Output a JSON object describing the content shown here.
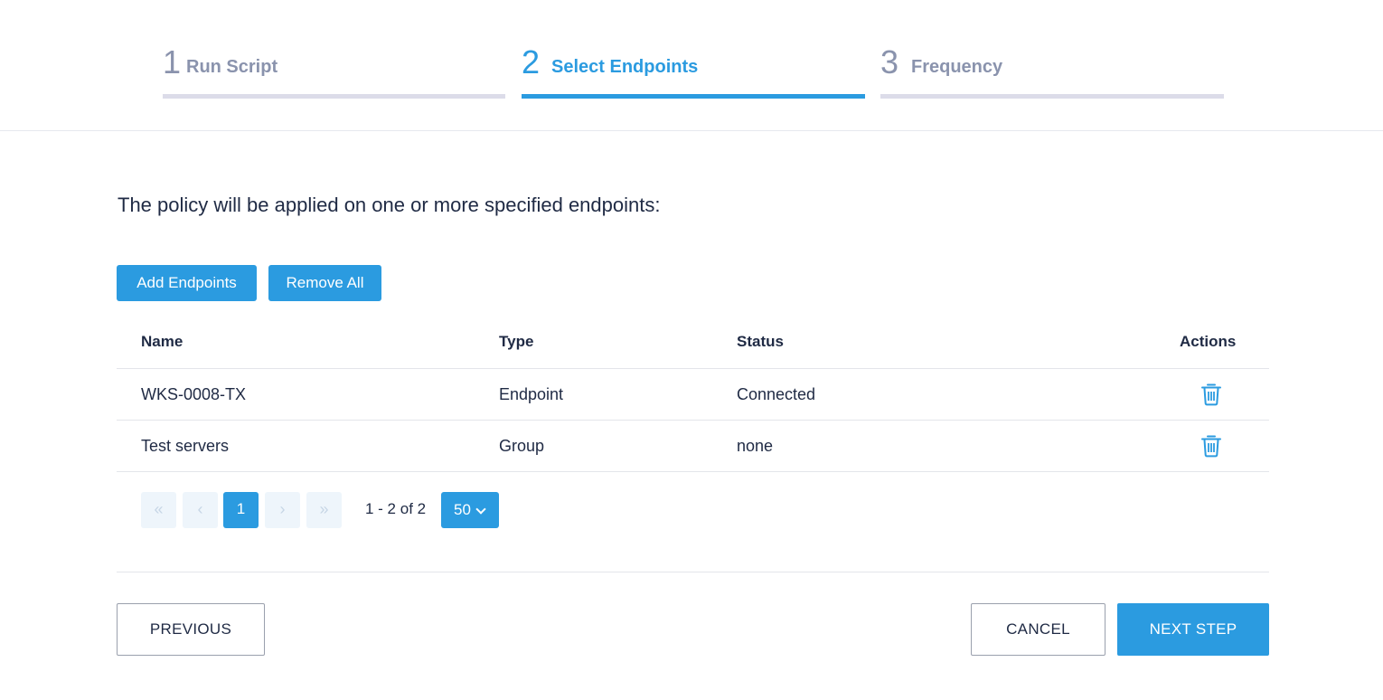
{
  "stepper": {
    "steps": [
      {
        "number": "1",
        "label": "Run Script"
      },
      {
        "number": "2",
        "label": "Select Endpoints"
      },
      {
        "number": "3",
        "label": "Frequency"
      }
    ],
    "active_step": 2
  },
  "intro_text": "The policy will be applied on one or more specified endpoints:",
  "toolbar": {
    "add_label": "Add Endpoints",
    "remove_all_label": "Remove All"
  },
  "table": {
    "columns": [
      "Name",
      "Type",
      "Status",
      "Actions"
    ],
    "rows": [
      {
        "name": "WKS-0008-TX",
        "type": "Endpoint",
        "status": "Connected",
        "action_icon": "trash-icon"
      },
      {
        "name": "Test servers",
        "type": "Group",
        "status": "none",
        "action_icon": "trash-icon"
      }
    ]
  },
  "pagination": {
    "first": "«",
    "prev": "‹",
    "current_page": "1",
    "next": "›",
    "last": "»",
    "range_text": "1 - 2 of 2",
    "page_size": "50"
  },
  "footer": {
    "previous_label": "PREVIOUS",
    "cancel_label": "CANCEL",
    "next_label": "NEXT STEP"
  },
  "colors": {
    "accent": "#2b9be0",
    "inactive_step": "#8a93ad",
    "text": "#1f2a44"
  }
}
